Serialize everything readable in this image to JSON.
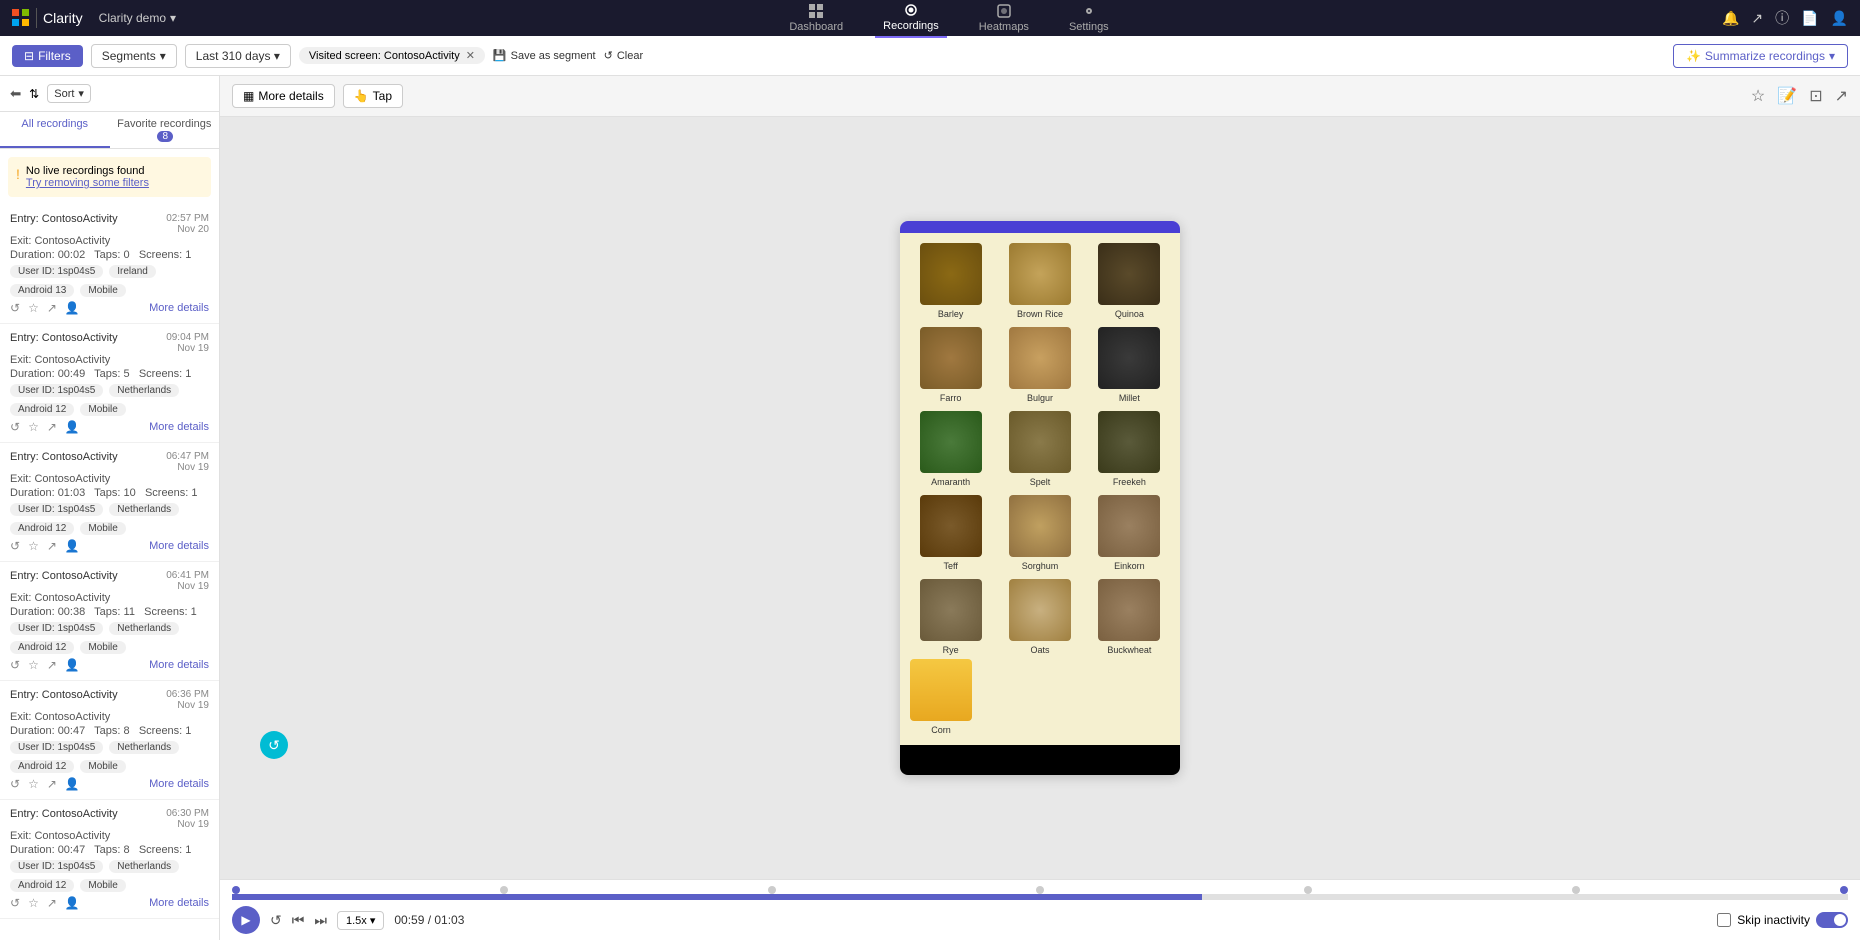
{
  "topnav": {
    "brand": "Clarity",
    "demo": "Clarity demo",
    "nav_items": [
      {
        "id": "dashboard",
        "label": "Dashboard",
        "active": false
      },
      {
        "id": "recordings",
        "label": "Recordings",
        "active": true
      },
      {
        "id": "heatmaps",
        "label": "Heatmaps",
        "active": false
      },
      {
        "id": "settings",
        "label": "Settings",
        "active": false
      }
    ]
  },
  "filterbar": {
    "filters_btn": "Filters",
    "segments_btn": "Segments",
    "days_btn": "Last 310 days",
    "chip_label": "Visited screen: ContosoActivity",
    "save_segment": "Save as segment",
    "clear": "Clear",
    "summarize": "Summarize recordings"
  },
  "sidebar": {
    "sort_label": "Sort",
    "tab_all": "All recordings",
    "tab_favorite": "Favorite recordings",
    "favorite_count": "8",
    "no_live_title": "No live recordings found",
    "no_live_link": "Try removing some filters",
    "recordings": [
      {
        "entry": "Entry: ContosoActivity",
        "exit": "Exit: ContosoActivity",
        "time": "02:57 PM",
        "date": "Nov 20",
        "duration": "00:02",
        "taps": "0",
        "screens": "1",
        "user_id": "1sp04s5",
        "country": "Ireland",
        "device": "Android 13",
        "type": "Mobile"
      },
      {
        "entry": "Entry: ContosoActivity",
        "exit": "Exit: ContosoActivity",
        "time": "09:04 PM",
        "date": "Nov 19",
        "duration": "00:49",
        "taps": "5",
        "screens": "1",
        "user_id": "1sp04s5",
        "country": "Netherlands",
        "device": "Android 12",
        "type": "Mobile"
      },
      {
        "entry": "Entry: ContosoActivity",
        "exit": "Exit: ContosoActivity",
        "time": "06:47 PM",
        "date": "Nov 19",
        "duration": "01:03",
        "taps": "10",
        "screens": "1",
        "user_id": "1sp04s5",
        "country": "Netherlands",
        "device": "Android 12",
        "type": "Mobile"
      },
      {
        "entry": "Entry: ContosoActivity",
        "exit": "Exit: ContosoActivity",
        "time": "06:41 PM",
        "date": "Nov 19",
        "duration": "00:38",
        "taps": "11",
        "screens": "1",
        "user_id": "1sp04s5",
        "country": "Netherlands",
        "device": "Android 12",
        "type": "Mobile"
      },
      {
        "entry": "Entry: ContosoActivity",
        "exit": "Exit: ContosoActivity",
        "time": "06:36 PM",
        "date": "Nov 19",
        "duration": "00:47",
        "taps": "8",
        "screens": "1",
        "user_id": "1sp04s5",
        "country": "Netherlands",
        "device": "Android 12",
        "type": "Mobile"
      },
      {
        "entry": "Entry: ContosoActivity",
        "exit": "Exit: ContosoActivity",
        "time": "06:30 PM",
        "date": "Nov 19",
        "duration": "00:47",
        "taps": "8",
        "screens": "1",
        "user_id": "1sp04s5",
        "country": "Netherlands",
        "device": "Android 12",
        "type": "Mobile"
      }
    ]
  },
  "player": {
    "more_details": "More details",
    "tap_label": "Tap",
    "grains": [
      {
        "name": "Barley",
        "class": "barley-img"
      },
      {
        "name": "Brown Rice",
        "class": "brownrice-img"
      },
      {
        "name": "Quinoa",
        "class": "quinoa-img"
      },
      {
        "name": "Farro",
        "class": "farro-img"
      },
      {
        "name": "Bulgur",
        "class": "bulgur-img"
      },
      {
        "name": "Millet",
        "class": "millet-img"
      },
      {
        "name": "Amaranth",
        "class": "amaranth-img"
      },
      {
        "name": "Spelt",
        "class": "spelt-img"
      },
      {
        "name": "Freekeh",
        "class": "freekeh-img"
      },
      {
        "name": "Teff",
        "class": "teff-img"
      },
      {
        "name": "Sorghum",
        "class": "sorghum-img"
      },
      {
        "name": "Einkorn",
        "class": "einkorn-img"
      },
      {
        "name": "Rye",
        "class": "rye-img"
      },
      {
        "name": "Oats",
        "class": "oats-img"
      },
      {
        "name": "Buckwheat",
        "class": "buckwheat-img"
      },
      {
        "name": "Corn",
        "class": "corn-img"
      }
    ]
  },
  "playback": {
    "speed": "1.5x",
    "current_time": "00:59",
    "total_time": "01:03",
    "time_display": "00:59 / 01:03",
    "skip_inactivity": "Skip inactivity"
  }
}
